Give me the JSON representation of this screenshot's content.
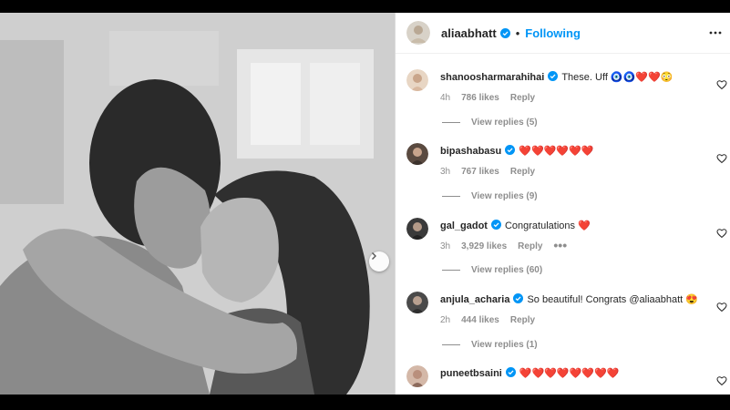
{
  "header": {
    "username": "aliaabhatt",
    "separator": "•",
    "follow_status": "Following"
  },
  "comments": [
    {
      "username": "shanoosharmarahihai",
      "text": "These. Uff 🧿🧿❤️❤️😳",
      "time": "4h",
      "likes": "786 likes",
      "reply": "Reply",
      "view_replies": "View replies (5)"
    },
    {
      "username": "bipashabasu",
      "text": "❤️❤️❤️❤️❤️❤️",
      "time": "3h",
      "likes": "767 likes",
      "reply": "Reply",
      "view_replies": "View replies (9)"
    },
    {
      "username": "gal_gadot",
      "text": "Congratulations ❤️",
      "time": "3h",
      "likes": "3,929 likes",
      "reply": "Reply",
      "more": "•••",
      "view_replies": "View replies (60)"
    },
    {
      "username": "anjula_acharia",
      "text": "So beautiful! Congrats @aliaabhatt 😍",
      "time": "2h",
      "likes": "444 likes",
      "reply": "Reply",
      "view_replies": "View replies (1)"
    },
    {
      "username": "puneetbsaini",
      "text": "❤️❤️❤️❤️❤️❤️❤️❤️"
    }
  ],
  "icons": {
    "verified": "verified-badge-icon",
    "heart": "heart-outline-icon",
    "more": "more-horizontal-icon",
    "next": "chevron-right-icon"
  },
  "colors": {
    "accent": "#0095f6",
    "verified": "#0095f6",
    "text": "#262626",
    "secondary": "#8e8e8e"
  }
}
